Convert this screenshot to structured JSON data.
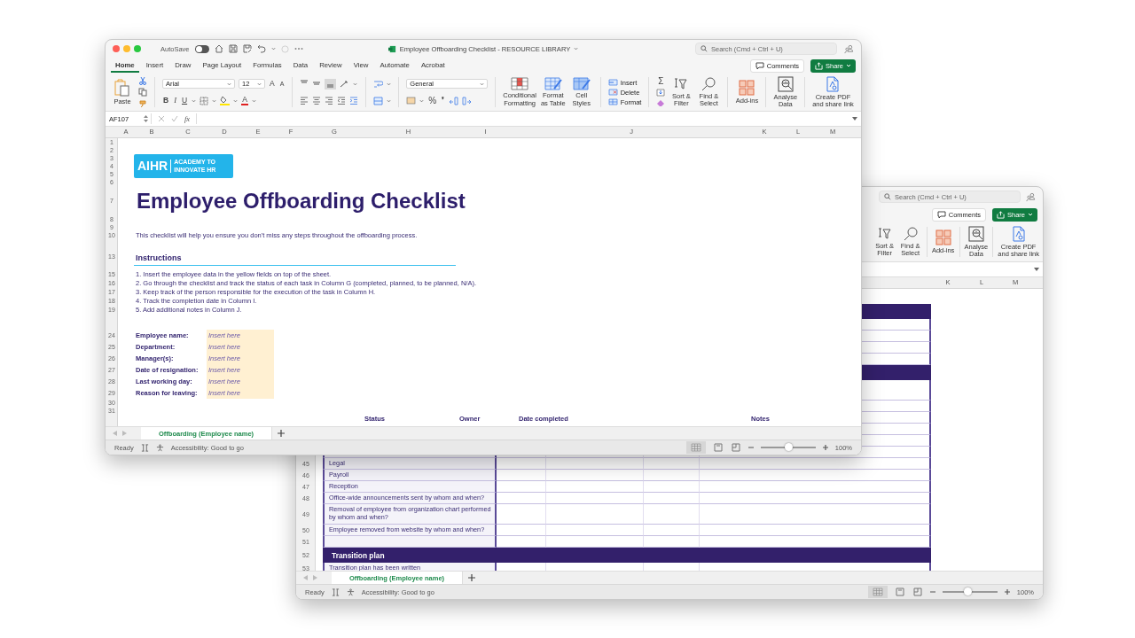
{
  "back_window": {
    "search": {
      "placeholder": "Search (Cmd + Ctrl + U)"
    },
    "comments": "Comments",
    "share": "Share",
    "ribbon": {
      "sort": "Sort &\nFilter",
      "find": "Find &\nSelect",
      "addins": "Add-ins",
      "analyse": "Analyse\nData",
      "pdf": "Create PDF\nand share link"
    },
    "columns": [
      "K",
      "L",
      "M"
    ],
    "rows": [
      {
        "kind": "gap"
      },
      {
        "kind": "section"
      },
      {
        "kind": "task"
      },
      {
        "kind": "task"
      },
      {
        "kind": "task"
      },
      {
        "kind": "task"
      },
      {
        "kind": "section"
      },
      {
        "kind": "tall"
      },
      {
        "kind": "task"
      },
      {
        "kind": "task"
      },
      {
        "kind": "task"
      },
      {
        "kind": "task"
      },
      {
        "kind": "task"
      },
      {
        "kind": "task",
        "num": "45",
        "label": "Legal"
      },
      {
        "kind": "task",
        "num": "46",
        "label": "Payroll"
      },
      {
        "kind": "task",
        "num": "47",
        "label": "Reception"
      },
      {
        "kind": "task",
        "num": "48",
        "label": "Office-wide announcements sent by whom and when?"
      },
      {
        "kind": "wrap",
        "num": "49",
        "label": "Removal of employee from organization chart performed by whom and when?"
      },
      {
        "kind": "task",
        "num": "50",
        "label": "Employee removed from website by whom and when?"
      },
      {
        "kind": "task",
        "num": "51"
      },
      {
        "kind": "section",
        "num": "52",
        "label": "Transition plan"
      },
      {
        "kind": "task",
        "num": "53",
        "label": "Transition plan has been written"
      }
    ],
    "sheet_tab": "Offboarding (Employee name)",
    "status": "Ready",
    "accessibility": "Accessibility: Good to go",
    "zoom": {
      "level": 0.45,
      "reading": "100%"
    }
  },
  "front_window": {
    "title": "Employee Offboarding Checklist - RESOURCE LIBRARY",
    "autosave": {
      "label": "AutoSave",
      "on": false
    },
    "search": {
      "placeholder": "Search (Cmd + Ctrl + U)"
    },
    "tabs": [
      {
        "label": "Home",
        "selected": true
      },
      {
        "label": "Insert",
        "selected": false
      },
      {
        "label": "Draw",
        "selected": false
      },
      {
        "label": "Page Layout",
        "selected": false
      },
      {
        "label": "Formulas",
        "selected": false
      },
      {
        "label": "Data",
        "selected": false
      },
      {
        "label": "Review",
        "selected": false
      },
      {
        "label": "View",
        "selected": false
      },
      {
        "label": "Automate",
        "selected": false
      },
      {
        "label": "Acrobat",
        "selected": false
      }
    ],
    "comments": "Comments",
    "share": "Share",
    "ribbon": {
      "paste": "Paste",
      "font": "Arial",
      "size": "12",
      "grow": "A",
      "shrink": "A",
      "bold": "B",
      "italic": "I",
      "underline": "U",
      "font_color": "A",
      "number_format": "General",
      "percent": "%",
      "comma": "❜",
      "conditional": "Conditional\nFormatting",
      "format_table": "Format\nas Table",
      "cell_styles": "Cell\nStyles",
      "insert": "Insert",
      "delete": "Delete",
      "format": "Format",
      "sum": "Σ",
      "sort": "Sort &\nFilter",
      "find": "Find &\nSelect",
      "addins": "Add-ins",
      "analyse": "Analyse\nData",
      "pdf": "Create PDF\nand share link"
    },
    "name_box": "AF107",
    "fx": "fx",
    "columns": [
      "A",
      "B",
      "C",
      "D",
      "E",
      "F",
      "G",
      "H",
      "I",
      "J",
      "K",
      "L",
      "M"
    ],
    "rows": [
      {
        "kind": "blank",
        "num": "1"
      },
      {
        "kind": "blank",
        "num": "2"
      },
      {
        "kind": "logo",
        "nums": [
          "3",
          "4",
          "5"
        ],
        "name": "AIHR",
        "tagline": "ACADEMY TO INNOVATE HR"
      },
      {
        "kind": "blank",
        "num": "6"
      },
      {
        "kind": "title",
        "num": "7",
        "text": "Employee Offboarding Checklist"
      },
      {
        "kind": "blank",
        "num": "8"
      },
      {
        "kind": "blank",
        "num": "9"
      },
      {
        "kind": "text",
        "num": "10",
        "text": "This checklist will help you ensure you don't miss any steps throughout the offboarding process."
      },
      {
        "kind": "gap"
      },
      {
        "kind": "gap"
      },
      {
        "kind": "heading",
        "num": "13",
        "text": "Instructions"
      },
      {
        "kind": "gap"
      },
      {
        "kind": "list",
        "num": "15",
        "text": "1. Insert the employee data in the yellow fields on top of the sheet."
      },
      {
        "kind": "list",
        "num": "16",
        "text": "2. Go through the checklist and track the status of each task in Column G (completed, planned, to be planned, N/A)."
      },
      {
        "kind": "list",
        "num": "17",
        "text": "3. Keep track of the person responsible for the execution of the task in Column H."
      },
      {
        "kind": "list",
        "num": "18",
        "text": "4. Track the completion date in Column I."
      },
      {
        "kind": "list",
        "num": "19",
        "text": "5. Add additional notes in Column J."
      },
      {
        "kind": "gap"
      },
      {
        "kind": "gap"
      },
      {
        "kind": "gap"
      },
      {
        "kind": "gap"
      },
      {
        "kind": "field",
        "num": "24",
        "label": "Employee name:",
        "value": "Insert here"
      },
      {
        "kind": "field",
        "num": "25",
        "label": "Department:",
        "value": "Insert here"
      },
      {
        "kind": "field",
        "num": "26",
        "label": "Manager(s):",
        "value": "Insert here"
      },
      {
        "kind": "field",
        "num": "27",
        "label": "Date of resignation:",
        "value": "Insert here"
      },
      {
        "kind": "field",
        "num": "28",
        "label": "Last working day:",
        "value": "Insert here"
      },
      {
        "kind": "field",
        "num": "29",
        "label": "Reason for leaving:",
        "value": "Insert here"
      },
      {
        "kind": "blank",
        "num": "30"
      },
      {
        "kind": "blank",
        "num": "31"
      },
      {
        "kind": "header",
        "cells": [
          "Status",
          "Owner",
          "Date completed",
          "Notes"
        ]
      }
    ],
    "sheet_tab": "Offboarding (Employee name)",
    "status": "Ready",
    "accessibility": "Accessibility: Good to go",
    "zoom": {
      "level": 0.5,
      "reading": "100%"
    }
  }
}
